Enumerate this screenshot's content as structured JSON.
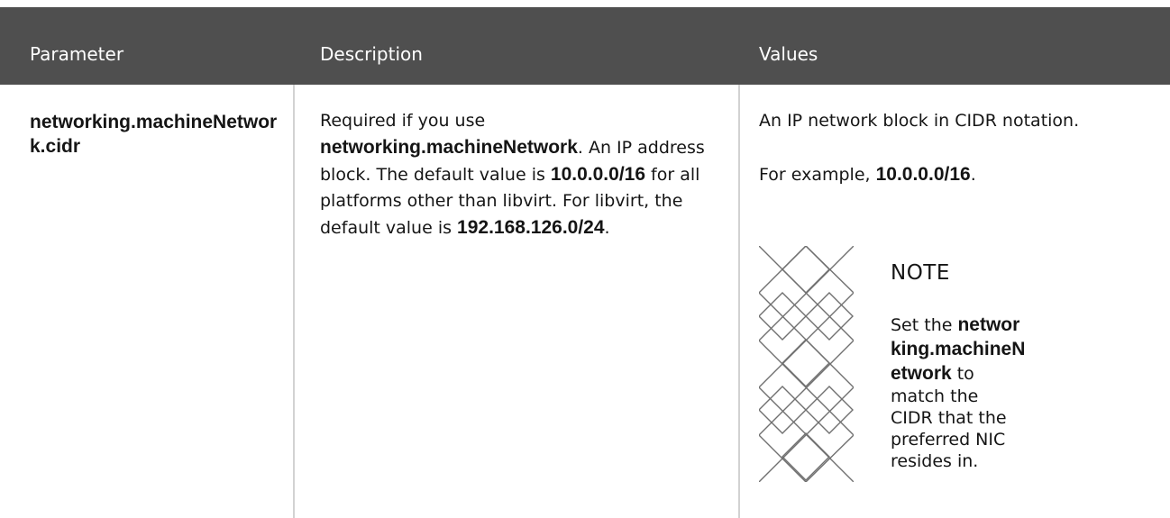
{
  "table": {
    "headers": [
      "Parameter",
      "Description",
      "Values"
    ],
    "row": {
      "parameter": "networking.machineNetwork.cidr",
      "description": {
        "t1": "Required if you use ",
        "b1": "networking.machineNetwork",
        "t2": ". An IP address block. The default value is ",
        "b2": "10.0.0.0/16",
        "t3": " for all platforms other than libvirt. For libvirt, the default value is ",
        "b3": "192.168.126.0/24",
        "t4": "."
      },
      "values": {
        "line1": "An IP network block in CIDR notation.",
        "example_prefix": "For example, ",
        "example_value": "10.0.0.0/16",
        "example_suffix": ".",
        "note": {
          "title": "NOTE",
          "t1": "Set the ",
          "b1": "networking.machineNetwork",
          "t2": " to match the CIDR that the preferred NIC resides in."
        }
      }
    }
  },
  "colors": {
    "header_bg": "#4f4f4f",
    "header_text": "#ffffff",
    "divider": "#d2d2d2",
    "text": "#151515"
  },
  "icons": {
    "note": "note-icon"
  }
}
